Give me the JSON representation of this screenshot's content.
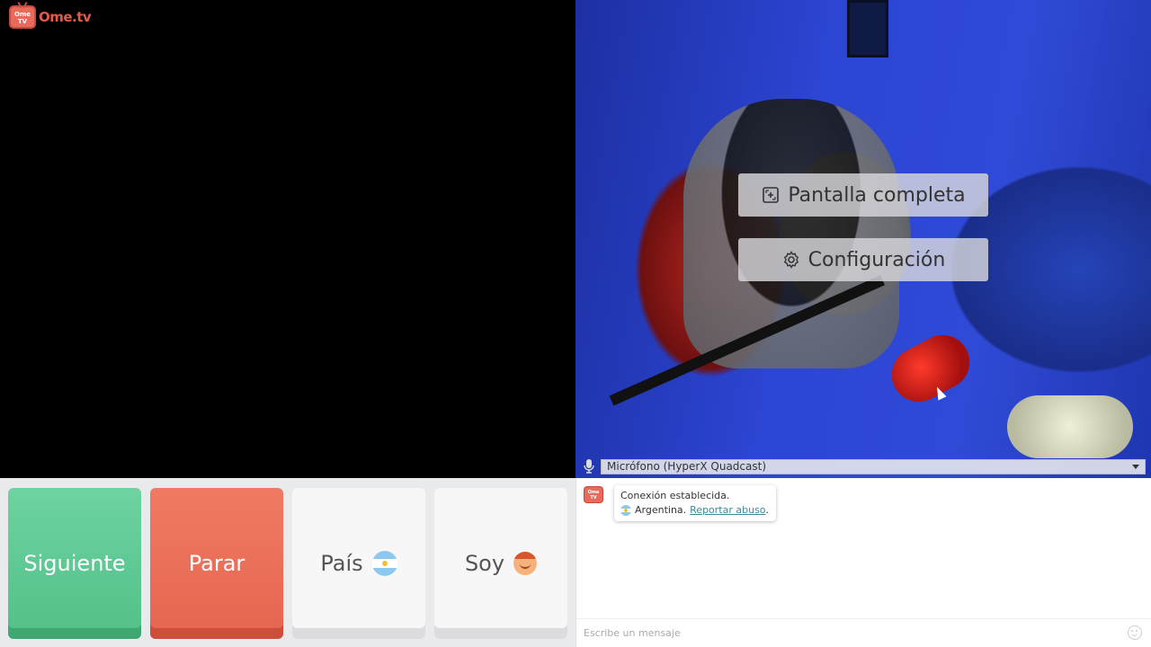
{
  "logo": {
    "badge": "Ome TV",
    "text": "Ome.tv"
  },
  "video_overlay": {
    "fullscreen_label": "Pantalla completa",
    "fullscreen_icon": "fullscreen-icon",
    "settings_label": "Configuración",
    "settings_icon": "gear-icon"
  },
  "microphone": {
    "icon": "microphone-icon",
    "selected": "Micrófono (HyperX Quadcast)"
  },
  "controls": {
    "next_label": "Siguiente",
    "stop_label": "Parar",
    "country_label": "País",
    "country_flag": "argentina-flag-icon",
    "gender_label": "Soy",
    "gender_icon": "boy-avatar-icon"
  },
  "chat": {
    "system_message": "Conexión establecida.",
    "country_name": "Argentina.",
    "report_link": "Reportar abuso",
    "report_suffix": ".",
    "input_placeholder": "Escribe un mensaje"
  },
  "colors": {
    "next": "#5ec995",
    "stop": "#ea6d57",
    "link": "#3a8a96",
    "brand": "#e35a48"
  }
}
